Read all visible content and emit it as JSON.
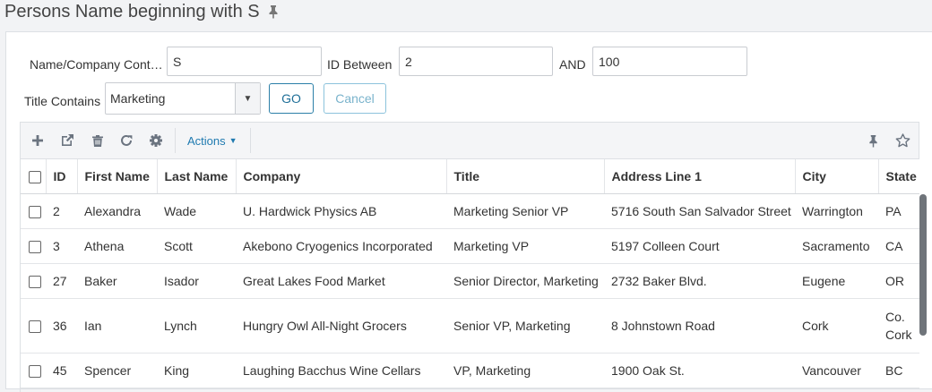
{
  "page": {
    "title": "Persons Name beginning with S"
  },
  "filters": {
    "name_label": "Name/Company Cont…",
    "name_value": "S",
    "id_between_label": "ID Between",
    "id_from": "2",
    "and_label": "AND",
    "id_to": "100",
    "title_label": "Title Contains",
    "title_value": "Marketing",
    "go_label": "GO",
    "cancel_label": "Cancel"
  },
  "toolbar": {
    "icons": [
      "plus-icon",
      "external-link-icon",
      "trash-icon",
      "refresh-icon",
      "gear-icon",
      "pin-icon",
      "star-icon"
    ],
    "actions_label": "Actions"
  },
  "table": {
    "columns": [
      "ID",
      "First Name",
      "Last Name",
      "Company",
      "Title",
      "Address Line 1",
      "City",
      "State"
    ],
    "rows": [
      {
        "id": "2",
        "first": "Alexandra",
        "last": "Wade",
        "company": "U. Hardwick Physics AB",
        "title": "Marketing Senior VP",
        "address": "5716 South San Salvador Street",
        "city": "Warrington",
        "state": "PA"
      },
      {
        "id": "3",
        "first": "Athena",
        "last": "Scott",
        "company": "Akebono Cryogenics Incorporated",
        "title": "Marketing VP",
        "address": "5197 Colleen Court",
        "city": "Sacramento",
        "state": "CA"
      },
      {
        "id": "27",
        "first": "Baker",
        "last": "Isador",
        "company": "Great Lakes Food Market",
        "title": "Senior Director, Marketing",
        "address": "2732 Baker Blvd.",
        "city": "Eugene",
        "state": "OR"
      },
      {
        "id": "36",
        "first": "Ian",
        "last": "Lynch",
        "company": "Hungry Owl All-Night Grocers",
        "title": "Senior VP, Marketing",
        "address": "8 Johnstown Road",
        "city": "Cork",
        "state": "Co. Cork"
      },
      {
        "id": "45",
        "first": "Spencer",
        "last": "King",
        "company": "Laughing Bacchus Wine Cellars",
        "title": "VP, Marketing",
        "address": "1900 Oak St.",
        "city": "Vancouver",
        "state": "BC"
      }
    ]
  },
  "colors": {
    "accent": "#1f7ab0",
    "go_border": "#2b7fa8",
    "cancel_border": "#8cc3dc"
  }
}
